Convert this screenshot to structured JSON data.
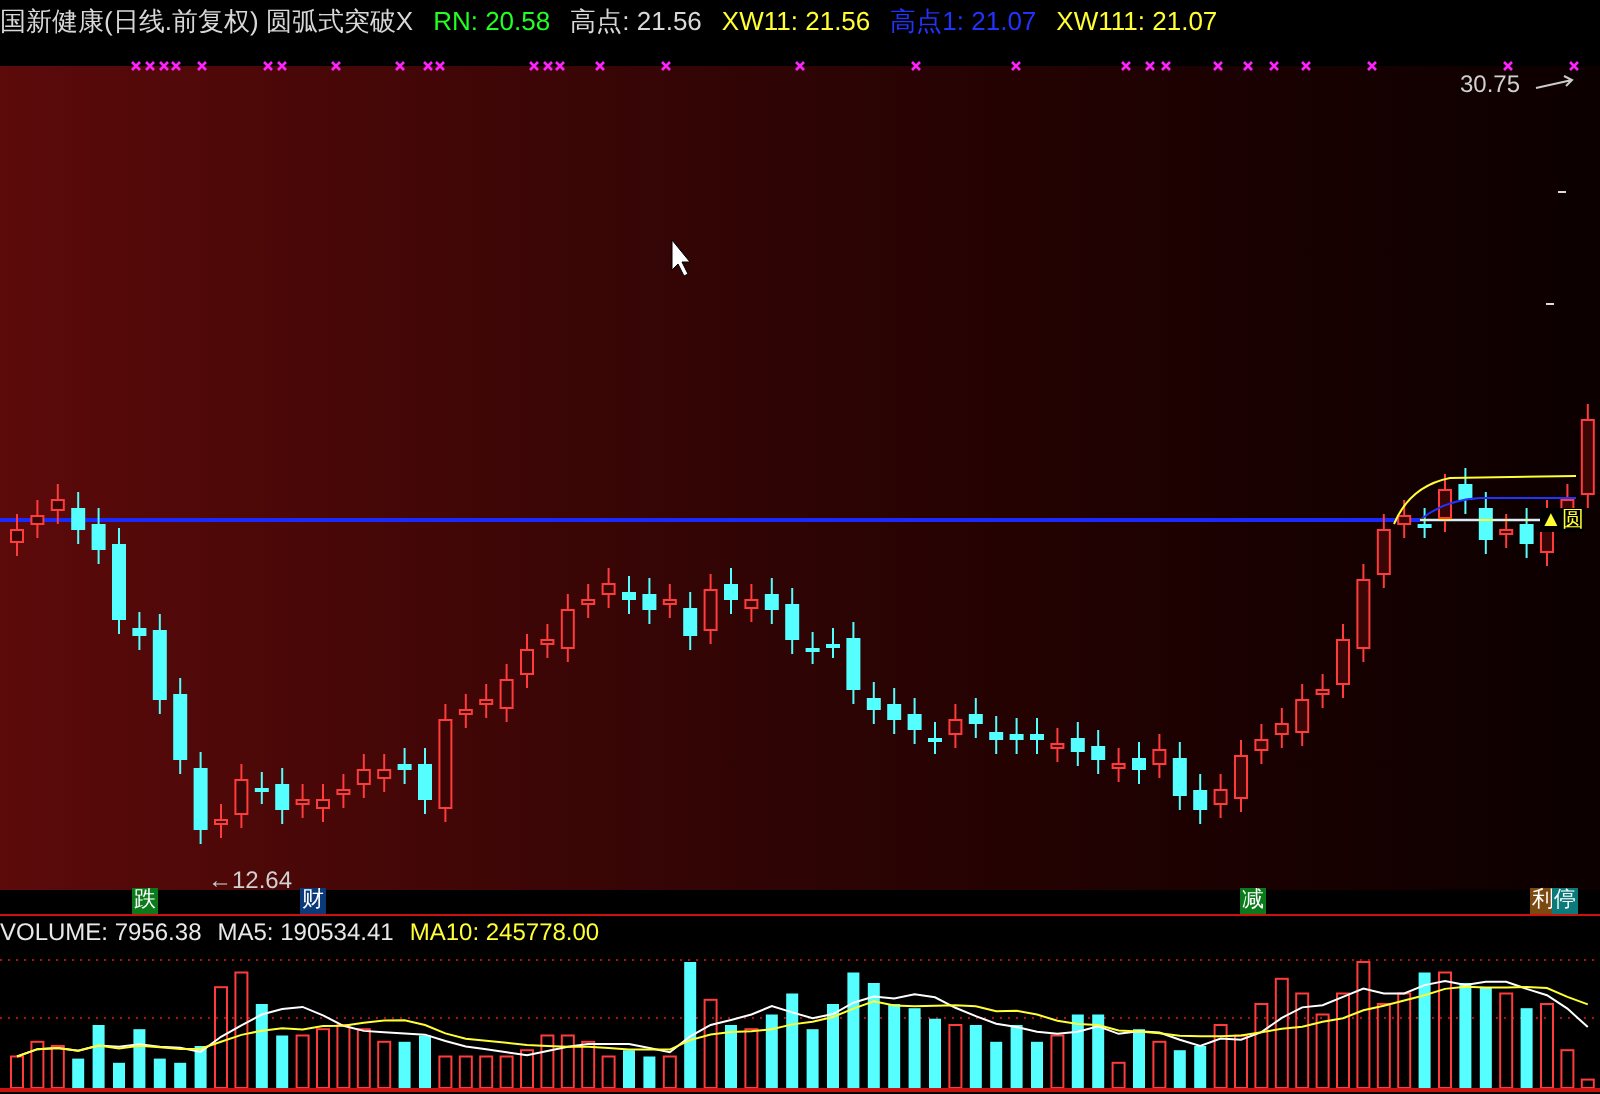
{
  "header": {
    "title": "国新健康(日线.前复权) 圆弧式突破X",
    "items": [
      {
        "label": "RN:",
        "value": "20.58",
        "color": "#22ff22"
      },
      {
        "label": "高点:",
        "value": "21.56",
        "color": "#d8d8d8"
      },
      {
        "label": "XW11:",
        "value": "21.56",
        "color": "#ffff33"
      },
      {
        "label": "高点1:",
        "value": "21.07",
        "color": "#2233ff"
      },
      {
        "label": "XW111:",
        "value": "21.07",
        "color": "#ffff33"
      }
    ]
  },
  "price_chart": {
    "max_label": "30.75",
    "min_label": "←12.64",
    "tag": "▲圆"
  },
  "signals": [
    {
      "text": "跌",
      "color": "#0a7a1a"
    },
    {
      "text": "财",
      "color": "#0a3a7a"
    },
    {
      "text": "减",
      "color": "#0a7a1a"
    },
    {
      "text": "利",
      "color": "#7a4a10"
    },
    {
      "text": "停",
      "color": "#0a7a7a"
    }
  ],
  "volume": {
    "items": [
      {
        "label": "VOLUME:",
        "value": "7956.38",
        "color": "#e8e8e8"
      },
      {
        "label": "MA5:",
        "value": "190534.41",
        "color": "#e8e8e8"
      },
      {
        "label": "MA10:",
        "value": "245778.00",
        "color": "#ffff33"
      }
    ]
  }
}
